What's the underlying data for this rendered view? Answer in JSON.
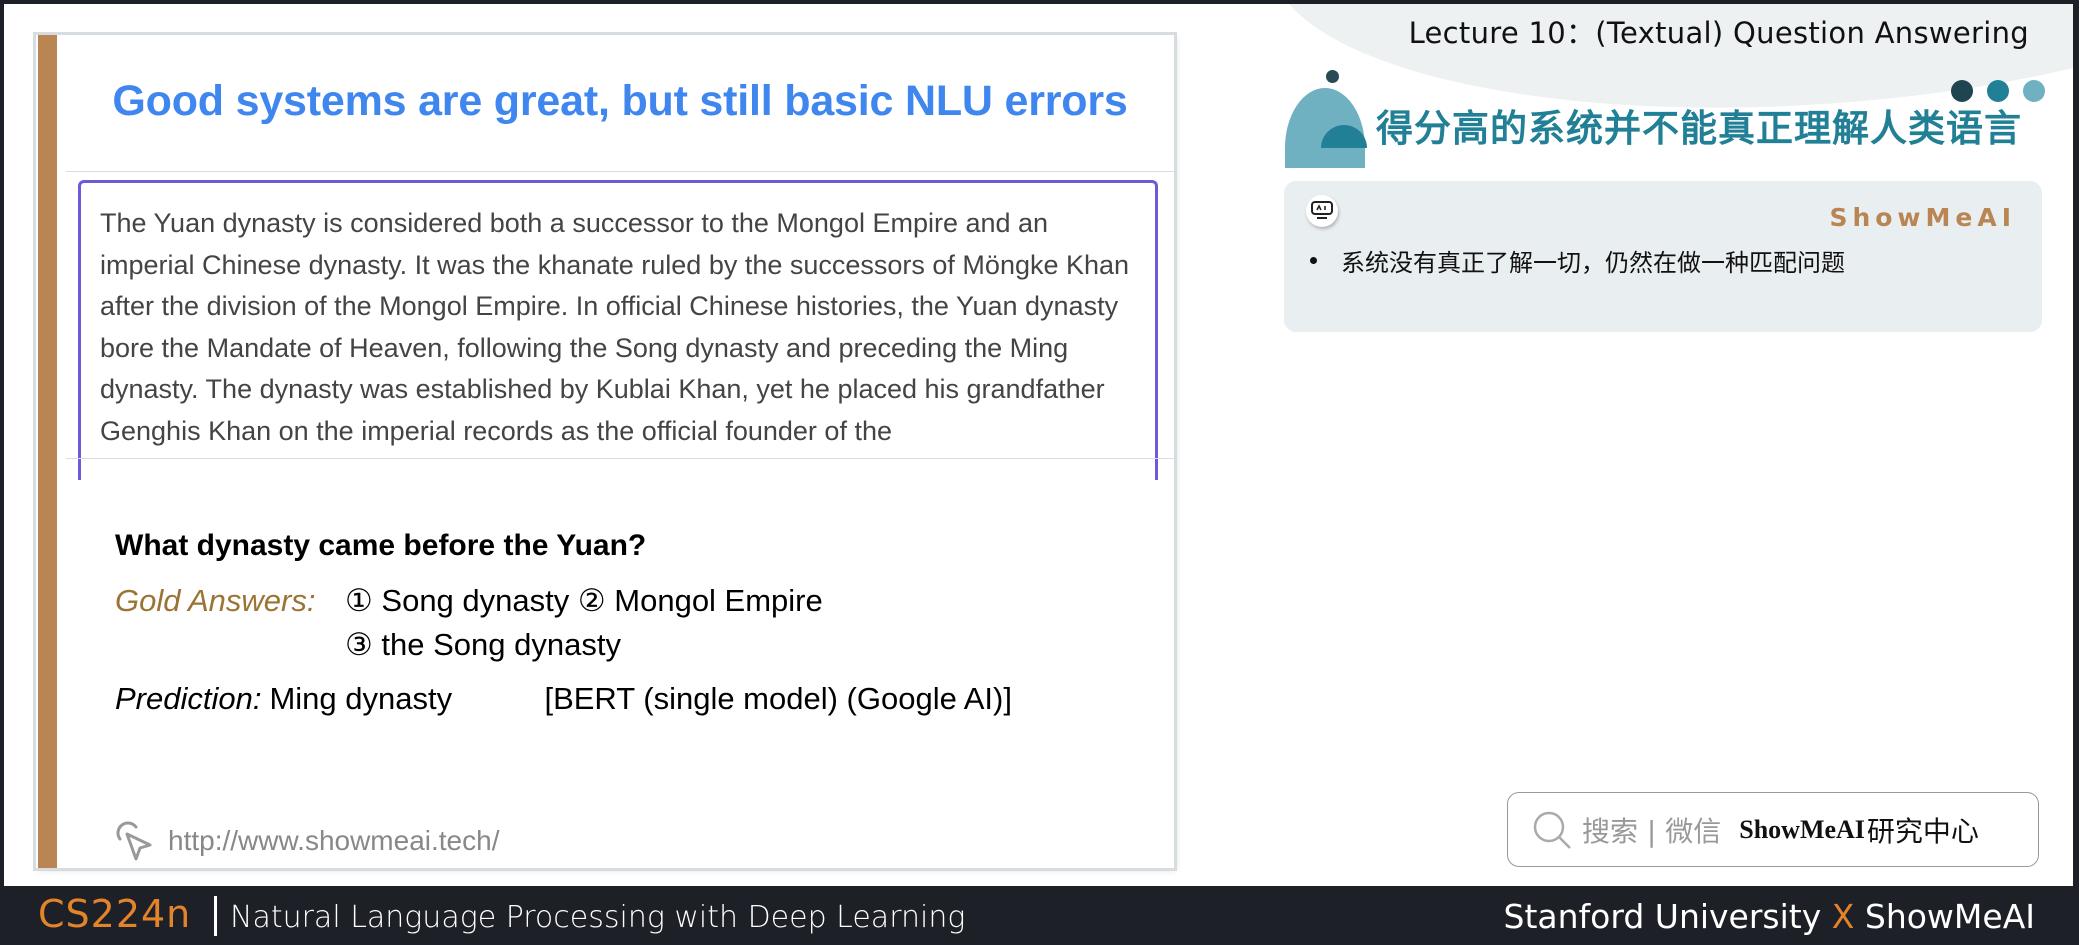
{
  "header": {
    "lecture_title": "Lecture 10：(Textual) Question Answering"
  },
  "slide": {
    "title": "Good systems are great, but still basic NLU errors",
    "passage": "The Yuan dynasty is considered both a successor to the Mongol Empire and an imperial Chinese dynasty. It was the khanate ruled by the successors of Möngke Khan after the division of the Mongol Empire. In official Chinese histories, the Yuan dynasty bore the Mandate of Heaven, following the Song dynasty and preceding the Ming dynasty. The dynasty was established by Kublai Khan, yet he placed his grandfather Genghis Khan on the imperial records as the official founder of the",
    "question": "What dynasty came before the Yuan?",
    "gold_label": "Gold Answers:",
    "gold_answers_line1": "①  Song dynasty ② Mongol Empire",
    "gold_answers_line2": "③ the Song dynasty",
    "prediction_label": "Prediction:",
    "prediction_value": "Ming dynasty",
    "model_label": "[BERT (single model) (Google AI)]",
    "url": "http://www.showmeai.tech/",
    "url_icon": "cursor-click-icon",
    "colors": {
      "title": "#3f86ef",
      "accent_bar": "#b98653",
      "passage_border": "#6e59d9",
      "gold_label": "#9b7433"
    }
  },
  "side": {
    "cn_title": "得分高的系统并不能真正理解人类语言",
    "info_box": {
      "icon": "ai-robot-icon",
      "brand": "ShowMeAI",
      "bullet": "系统没有真正了解一切，仍然在做一种匹配问题"
    },
    "search": {
      "icon": "search-icon",
      "hint": "搜索 | 微信",
      "brand": "ShowMeAI",
      "brand_cn": "研究中心"
    },
    "colors": {
      "title": "#217f96",
      "brand": "#b98653"
    }
  },
  "footer": {
    "course_code": "CS224n",
    "course_name": "Natural Language Processing with Deep Learning",
    "partner_left": "Stanford University",
    "partner_x": "X",
    "partner_right": "ShowMeAI"
  }
}
